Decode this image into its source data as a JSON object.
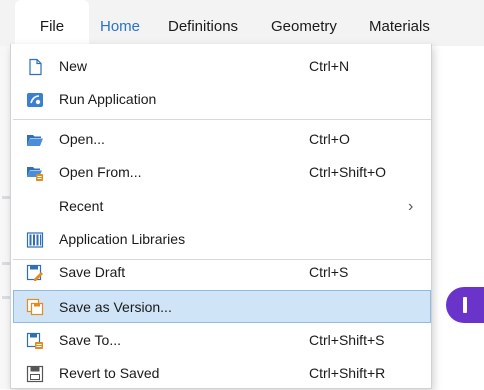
{
  "ribbon": {
    "tabs": {
      "file": "File",
      "home": "Home",
      "definitions": "Definitions",
      "geometry": "Geometry",
      "materials": "Materials"
    },
    "active_tab": "Home",
    "accent_color": "#2a73c4"
  },
  "file_menu": {
    "items": [
      {
        "label": "New",
        "shortcut": "Ctrl+N",
        "icon": "new-file-icon"
      },
      {
        "label": "Run Application",
        "shortcut": "",
        "icon": "run-application-icon"
      },
      {
        "label": "Open...",
        "shortcut": "Ctrl+O",
        "icon": "folder-open-icon"
      },
      {
        "label": "Open From...",
        "shortcut": "Ctrl+Shift+O",
        "icon": "open-from-icon"
      },
      {
        "label": "Recent",
        "shortcut": "",
        "icon": "",
        "submenu_indicator": "›"
      },
      {
        "label": "Application Libraries",
        "shortcut": "",
        "icon": "application-libraries-icon"
      },
      {
        "label": "Save Draft",
        "shortcut": "Ctrl+S",
        "icon": "save-draft-icon"
      },
      {
        "label": "Save as Version...",
        "shortcut": "",
        "icon": "save-as-version-icon",
        "highlighted": true
      },
      {
        "label": "Save To...",
        "shortcut": "Ctrl+Shift+S",
        "icon": "save-to-icon"
      },
      {
        "label": "Revert to Saved",
        "shortcut": "Ctrl+Shift+R",
        "icon": "revert-to-saved-icon"
      }
    ],
    "highlight_color": "#cfe4f7"
  },
  "cursor_indicator": {
    "color": "#6a33c9"
  }
}
